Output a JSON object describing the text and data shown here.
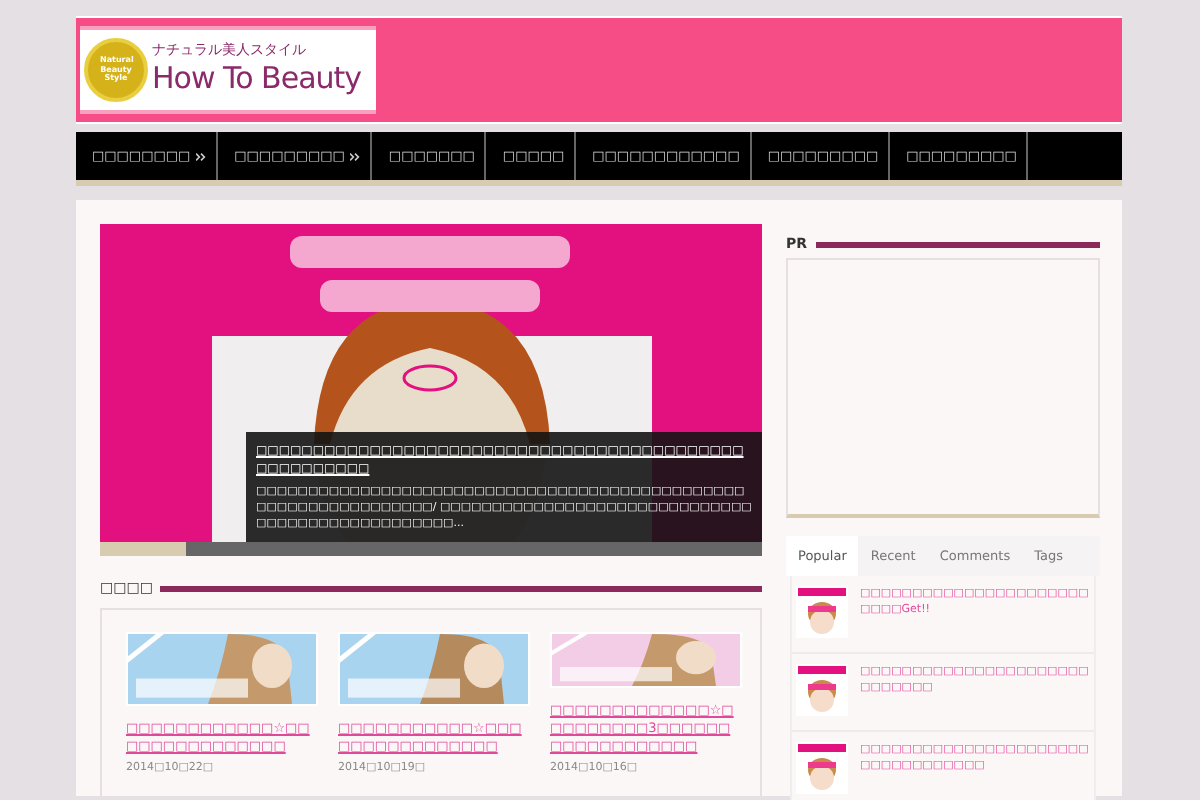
{
  "logo": {
    "tagline": "ナチュラル美人スタイル",
    "name": "How To Beauty",
    "badge": "Natural Beauty Style"
  },
  "nav": [
    {
      "label": "□□□□□□□□",
      "has_submenu": true
    },
    {
      "label": "□□□□□□□□□",
      "has_submenu": true
    },
    {
      "label": "□□□□□□□",
      "has_submenu": false
    },
    {
      "label": "□□□□□",
      "has_submenu": false
    },
    {
      "label": "□□□□□□□□□□□□",
      "has_submenu": false
    },
    {
      "label": "□□□□□□□□□",
      "has_submenu": false
    },
    {
      "label": "□□□□□□□□□",
      "has_submenu": false
    }
  ],
  "slider": {
    "title": "□□□□□□□□□□□□□□□□□□□□□□□□□□□□□□□□□□□□□□□□□□□□□□□□□□□□□",
    "excerpt": "□□□□□□□□□□□□□□□□□□□□□□□□□□□□□□□□□□□□□□□□□□□□□□□□□□□□□□□□□□□□□□□□/ □□□□□□□□□□□□□□□□□□□□□□□□□□□□□□□□□□□□□□□□□□□□□□□□□...",
    "level": 0.13
  },
  "section": {
    "title": "□□□□"
  },
  "posts": [
    {
      "title": "□□□□□□□□□□□□☆□□□□□□□□□□□□□□□",
      "date": "2014□10□22□"
    },
    {
      "title": "□□□□□□□□□□□☆□□□□□□□□□□□□□□□□",
      "date": "2014□10□19□"
    },
    {
      "title": "□□□□□□□□□□□□□☆□□□□□□□□□3□□□□□□□□□□□□□□□□□□",
      "date": "2014□10□16□"
    }
  ],
  "sidebar": {
    "pr_title": "PR",
    "tabs": [
      {
        "label": "Popular",
        "selected": true
      },
      {
        "label": "Recent",
        "selected": false
      },
      {
        "label": "Comments",
        "selected": false
      },
      {
        "label": "Tags",
        "selected": false
      }
    ],
    "items": [
      {
        "title": "□□□□□□□□□□□□□□□□□□□□□□□□□□Get!!"
      },
      {
        "title": "□□□□□□□□□□□□□□□□□□□□□□□□□□□□□"
      },
      {
        "title": "□□□□□□□□□□□□□□□□□□□□□□□□□□□□□□□□□□"
      }
    ]
  }
}
